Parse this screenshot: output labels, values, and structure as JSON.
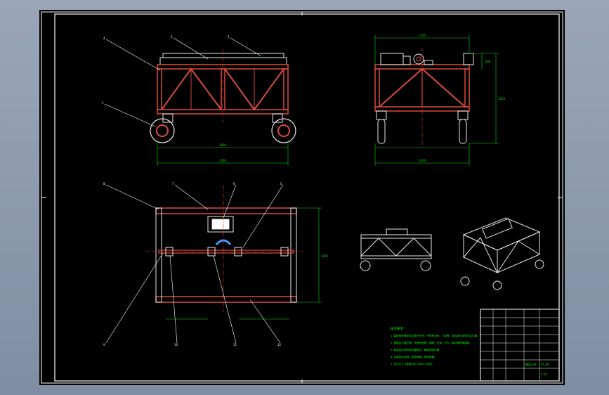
{
  "drawing": {
    "part_labels_front": [
      "4",
      "3",
      "2",
      "1"
    ],
    "part_labels_top": [
      "8",
      "7",
      "6",
      "5",
      "9",
      "10",
      "11",
      "12"
    ],
    "dims_front": [
      "1800",
      "1300"
    ],
    "dims_side": [
      "1100",
      "1200",
      "800",
      "1300"
    ],
    "dims_top": [
      "1850"
    ],
    "notes": [
      "技术要求：",
      "1. 装配前所有零件应清洗干净，不得有毛刺、飞边等，各运动件运转灵活可靠。",
      "2. 焊缝应平整光滑，不得有虚焊、漏焊、夹渣、气孔、裂纹等焊接缺陷。",
      "3. 组装后应检查各连接部位，确保紧固可靠。",
      "4. 涂装前应除锈，底漆两遍，面漆两遍。",
      "5. 未注尺寸公差按GB/T1804-m执行。"
    ],
    "title_block": {
      "name": "搬运小车",
      "code": "ZC-00",
      "scale": "1:10"
    }
  },
  "colors": {
    "sheet": "#000000",
    "border": "#ffffff",
    "frame": "#d94a3c",
    "steel": "#e8e8e8",
    "dimension": "#00e000",
    "leader": "#ffffff",
    "notes": "#00ff00",
    "centerline": "#ff3030"
  }
}
